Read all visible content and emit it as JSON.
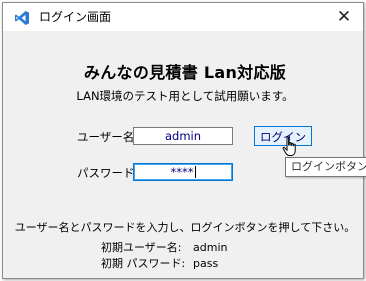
{
  "window": {
    "title": "ログイン画面",
    "icon": "visual-studio-icon",
    "close_glyph": "✕",
    "accent": "#0078d7"
  },
  "form": {
    "heading": "みんなの見積書 Lan対応版",
    "subheading": "LAN環境のテスト用として試用願います。",
    "username_label": "ユーザー名",
    "username_value": "admin",
    "password_label": "パスワード",
    "password_value": "****",
    "login_button": "ログイン",
    "tooltip": "ログインボタン"
  },
  "footer": {
    "instruction": "ユーザー名とパスワードを入力し、ログインボタンを押して下さい。",
    "initial_user_label": "初期ユーザー名:",
    "initial_user_value": "admin",
    "initial_pass_label": "初期 パスワード:",
    "initial_pass_value": "pass"
  }
}
